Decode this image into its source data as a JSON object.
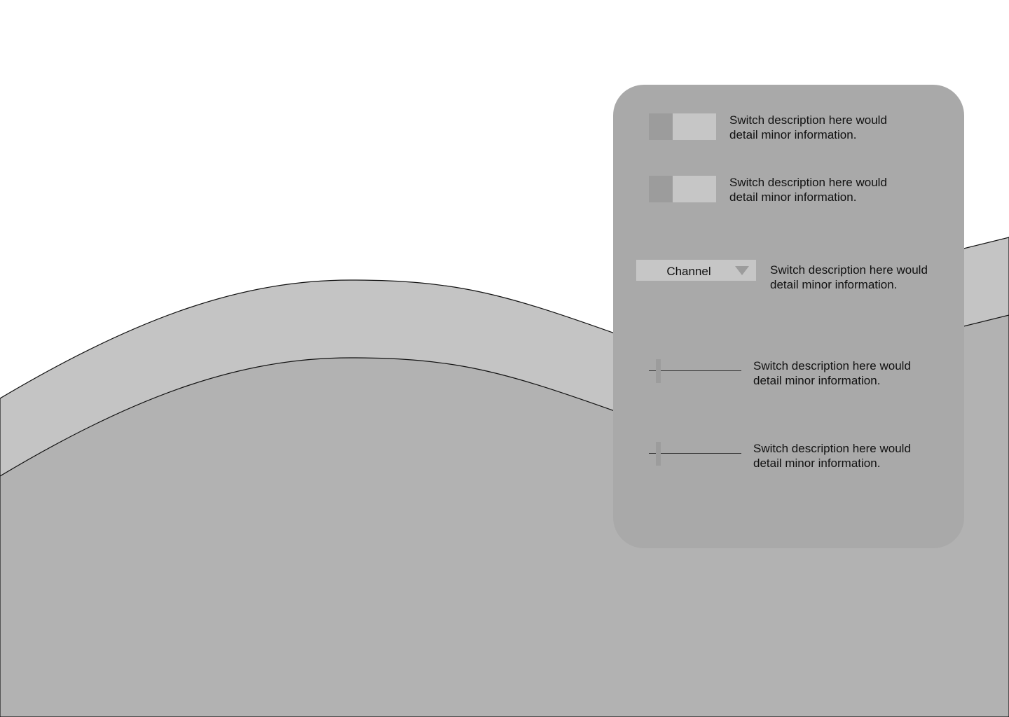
{
  "colors": {
    "background": "#ffffff",
    "wave_light": "#c4c4c4",
    "wave_dark": "#b2b2b2",
    "panel": "#a9a9a9",
    "control_fill": "#c6c6c6",
    "control_accent": "#9c9c9c",
    "text": "#111111"
  },
  "panel": {
    "toggles": [
      {
        "description": "Switch description here would\ndetail minor information.",
        "state": "off"
      },
      {
        "description": "Switch description here would\ndetail minor information.",
        "state": "off"
      }
    ],
    "select": {
      "value": "Channel",
      "icon": "chevron-down-icon",
      "description": "Switch description here would\ndetail minor information."
    },
    "sliders": [
      {
        "value": 0.08,
        "description": "Switch description here would\ndetail minor information."
      },
      {
        "value": 0.08,
        "description": "Switch description here would\ndetail minor information."
      }
    ]
  }
}
